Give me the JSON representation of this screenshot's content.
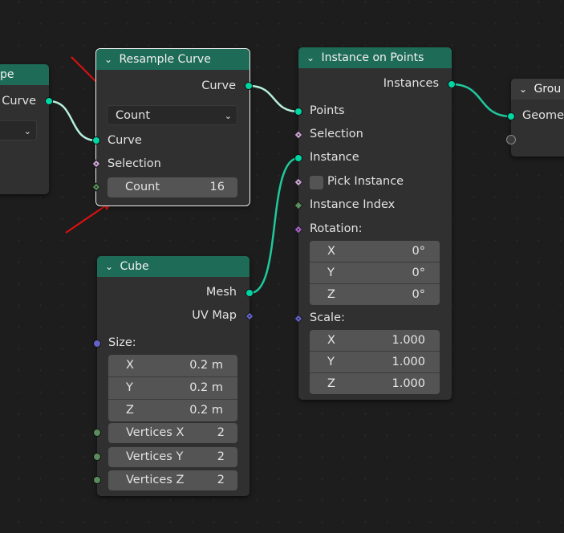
{
  "nodes": {
    "left_partial": {
      "title": "pe",
      "curve_label": "Curve"
    },
    "resample": {
      "title": "Resample Curve",
      "output_curve": "Curve",
      "mode_value": "Count",
      "input_curve": "Curve",
      "input_selection": "Selection",
      "count_label": "Count",
      "count_value": "16"
    },
    "instance_on_points": {
      "title": "Instance on Points",
      "output_instances": "Instances",
      "points": "Points",
      "selection": "Selection",
      "instance": "Instance",
      "pick_instance": "Pick Instance",
      "instance_index": "Instance Index",
      "rotation": "Rotation:",
      "rotation_values": [
        {
          "axis": "X",
          "value": "0°"
        },
        {
          "axis": "Y",
          "value": "0°"
        },
        {
          "axis": "Z",
          "value": "0°"
        }
      ],
      "scale": "Scale:",
      "scale_values": [
        {
          "axis": "X",
          "value": "1.000"
        },
        {
          "axis": "Y",
          "value": "1.000"
        },
        {
          "axis": "Z",
          "value": "1.000"
        }
      ]
    },
    "cube": {
      "title": "Cube",
      "output_mesh": "Mesh",
      "output_uv": "UV Map",
      "size": "Size:",
      "size_values": [
        {
          "axis": "X",
          "value": "0.2 m"
        },
        {
          "axis": "Y",
          "value": "0.2 m"
        },
        {
          "axis": "Z",
          "value": "0.2 m"
        }
      ],
      "vertices_x_label": "Vertices X",
      "vertices_x": "2",
      "vertices_y_label": "Vertices Y",
      "vertices_y": "2",
      "vertices_z_label": "Vertices Z",
      "vertices_z": "2"
    },
    "group_output": {
      "title": "Grou",
      "geometry": "Geomet"
    }
  },
  "colors": {
    "header": "#1e6b57",
    "geometry_socket": "#00d6a3",
    "annotation_arrow": "#e01010",
    "node_body": "#303030"
  }
}
